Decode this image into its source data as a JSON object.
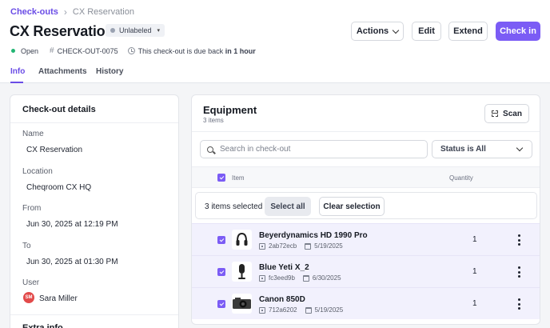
{
  "breadcrumb": {
    "parent": "Check-outs",
    "current": "CX Reservation"
  },
  "header": {
    "title": "CX Reservation",
    "label": "Unlabeled",
    "actions": {
      "actions": "Actions",
      "edit": "Edit",
      "extend": "Extend",
      "check_in": "Check in"
    }
  },
  "meta": {
    "status": "Open",
    "code": "CHECK-OUT-0075",
    "due_prefix": "This check-out is due back",
    "due_value": "in 1 hour"
  },
  "tabs": [
    "Info",
    "Attachments",
    "History"
  ],
  "details": {
    "heading": "Check-out details",
    "name_label": "Name",
    "name_value": "CX Reservation",
    "location_label": "Location",
    "location_value": "Cheqroom CX HQ",
    "from_label": "From",
    "from_value": "Jun 30, 2025 at 12:19 PM",
    "to_label": "To",
    "to_value": "Jun 30, 2025 at 01:30 PM",
    "user_label": "User",
    "user_initials": "SM",
    "user_value": "Sara Miller",
    "extra_heading": "Extra info"
  },
  "equipment": {
    "title": "Equipment",
    "count": "3 items",
    "scan": "Scan",
    "search_placeholder": "Search in check-out",
    "status_filter": "Status is All",
    "col_item": "Item",
    "col_quantity": "Quantity",
    "selected_text": "3 items selected",
    "select_all": "Select all",
    "clear_selection": "Clear selection",
    "items": [
      {
        "name": "Beyerdynamics HD 1990 Pro",
        "code": "2ab72ecb",
        "date": "5/19/2025",
        "quantity": "1",
        "thumb": "headphones"
      },
      {
        "name": "Blue Yeti X_2",
        "code": "fc3eed9b",
        "date": "6/30/2025",
        "quantity": "1",
        "thumb": "microphone"
      },
      {
        "name": "Canon 850D",
        "code": "712a6202",
        "date": "5/19/2025",
        "quantity": "1",
        "thumb": "camera"
      }
    ]
  },
  "colors": {
    "accent": "#7b5cf5",
    "open_status": "#22b573",
    "avatar": "#e24a4a"
  }
}
